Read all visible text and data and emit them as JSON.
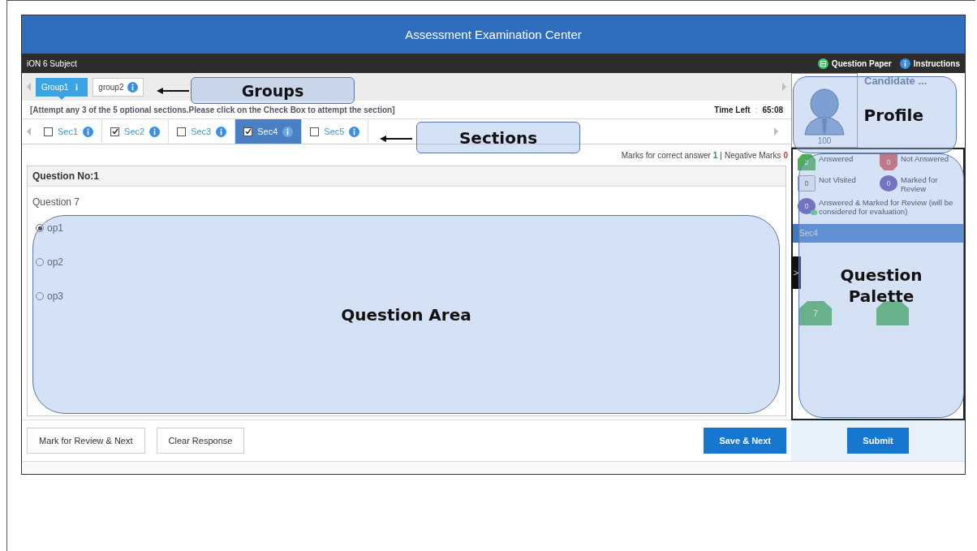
{
  "window": {
    "title": "Assessment Examination Center"
  },
  "toolbar": {
    "subject": "iON 6 Subject",
    "links": [
      {
        "label": "Question Paper",
        "kind": "paper"
      },
      {
        "label": "Instructions",
        "kind": "info"
      }
    ]
  },
  "groups": [
    {
      "label": "Group1",
      "selected": true
    },
    {
      "label": "group2",
      "selected": false
    }
  ],
  "instruction": "[Attempt any 3 of the 5 optional sections.Please click on the Check Box to attempt the section]",
  "timer": {
    "label": "Time Left",
    "separator": ":",
    "value": "65:08"
  },
  "sections": [
    {
      "label": "Sec1",
      "checked": false,
      "selected": false
    },
    {
      "label": "Sec2",
      "checked": true,
      "selected": false
    },
    {
      "label": "Sec3",
      "checked": false,
      "selected": false
    },
    {
      "label": "Sec4",
      "checked": true,
      "selected": true
    },
    {
      "label": "Sec5",
      "checked": false,
      "selected": false
    }
  ],
  "marks": {
    "correct_label": "Marks for correct answer",
    "correct": "1",
    "separator": "|",
    "negative_label": "Negative Marks",
    "negative": "0"
  },
  "question": {
    "number": "Question No:1",
    "text": "Question 7",
    "options": [
      {
        "label": "op1",
        "selected": true
      },
      {
        "label": "op2",
        "selected": false
      },
      {
        "label": "op3",
        "selected": false
      }
    ]
  },
  "actions": [
    "Mark for Review & Next",
    "Clear Response"
  ],
  "save_button": "Save & Next",
  "submit_button": "Submit",
  "profile": {
    "name": "Candidate ...",
    "score": "100"
  },
  "legend": [
    {
      "count": "2",
      "label": "Answered",
      "kind": "answered"
    },
    {
      "count": "0",
      "label": "Not Answered",
      "kind": "not_answered"
    },
    {
      "count": "0",
      "label": "Not Visited",
      "kind": "not_visited"
    },
    {
      "count": "0",
      "label": "Marked for Review",
      "kind": "marked"
    },
    {
      "count": "0",
      "label": "Answered & Marked for Review (will be considered for evaluation)",
      "kind": "answered_marked"
    }
  ],
  "palette": {
    "section": "Sec4",
    "toggle": ">",
    "buttons": [
      {
        "number": "7",
        "kind": "answered"
      },
      {
        "kind": "answered"
      }
    ]
  },
  "annotations": [
    {
      "label": "Groups",
      "kind": "groups"
    },
    {
      "label": "Sections",
      "kind": "sections"
    },
    {
      "label": "Profile",
      "kind": "profile"
    },
    {
      "label": "Question Area",
      "kind": "question_area"
    },
    {
      "label": "Question Palette",
      "kind": "palette"
    }
  ]
}
